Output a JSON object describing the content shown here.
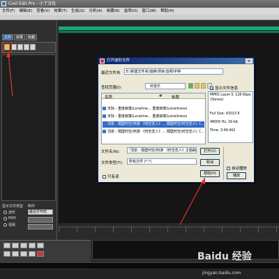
{
  "window": {
    "title": "Cool Edit Pro  - 小丁汉化"
  },
  "menubar": {
    "items": [
      "文件(F)",
      "编辑(E)",
      "查看(V)",
      "效果(T)",
      "生成(G)",
      "分析(A)",
      "收藏(R)",
      "选项(O)",
      "窗口(W)",
      "帮助(H)"
    ]
  },
  "left_panel": {
    "tabs": [
      "文件",
      "效果",
      "收藏"
    ],
    "file_type_label": "显示文件类型",
    "effects_label": "制作",
    "radios": [
      "波形",
      "MIDI",
      "视频"
    ],
    "effects_select": "最近打开的"
  },
  "dialog": {
    "title": "打开波形文件",
    "recent_label": "最近文件夹",
    "recent_path": "E:\\新建文件夹\\旭峰\\项目\\音频\\宇婷",
    "lookin_label": "查找范围(I):",
    "lookin_value": "铃音乐",
    "columns": [
      "名称",
      "#",
      "标题"
    ],
    "files": [
      {
        "name": "天际 - 重度寂寞(Loneline...",
        "title": "重度寂寞(Loneliness)"
      },
      {
        "name": "天际 - 重度寂寞(Loneline...",
        "title": "重度寂寞(Loneliness)"
      },
      {
        "name": "羽泉 - 隔壁时空(阿游 《时空恋人》...",
        "title": "隔壁时空(时空恋人)《..."
      },
      {
        "name": "羽泉 - 隔壁时空(阿游 《时空恋人》...",
        "title": "隔壁时空(时空恋人)《..."
      }
    ],
    "show_info_label": "显示文件信息",
    "info": [
      "MPEG Layer-3, 128 Kbps",
      "(Stereo)",
      "Full Size: 43013 K",
      "48000 Hz, 16-bit,",
      "Time:   3:49.402"
    ],
    "filename_label": "文件名(N):",
    "filename_value": "\"羽泉 - 隔壁时空(阿游 《时空恋人》主题曲",
    "filetype_label": "文件类型(T):",
    "filetype_value": "所有文件 (*.*)",
    "open_label": "打开(O)",
    "cancel_label": "取消",
    "help_label": "帮助(H)",
    "readonly_label": "只有读",
    "autoplay_label": "自动播放",
    "play_label": "播放"
  },
  "watermark": {
    "brand": "Baidu 经验",
    "url": "jingyan.baidu.com"
  },
  "colors": {
    "highlight": "#e3342f",
    "accent": "#19a97b",
    "dialog_title": "#0a246a"
  }
}
